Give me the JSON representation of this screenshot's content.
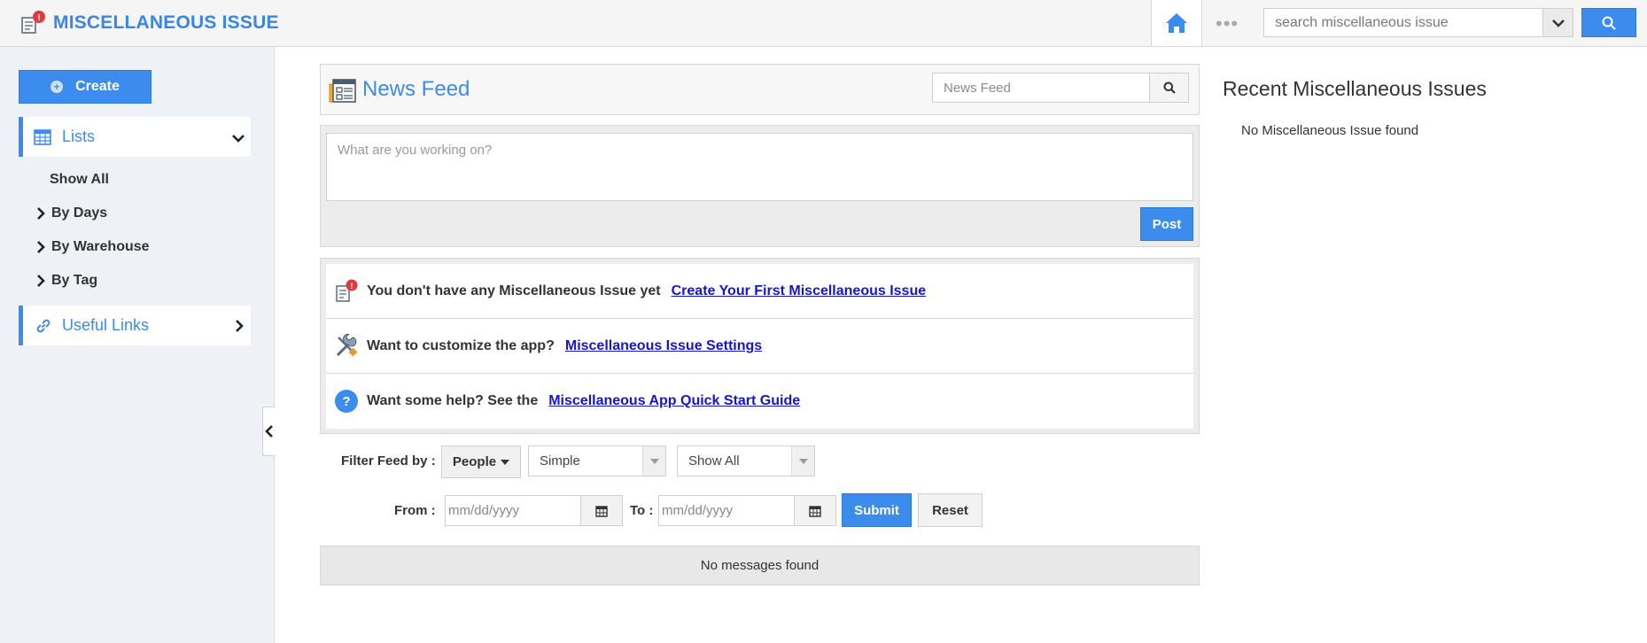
{
  "header": {
    "app_title": "MISCELLANEOUS ISSUE",
    "search_placeholder": "search miscellaneous issue",
    "more_dots": "•••",
    "badge": "!"
  },
  "sidebar": {
    "create_label": "Create",
    "lists_label": "Lists",
    "items": [
      {
        "label": "Show All"
      },
      {
        "label": "By Days"
      },
      {
        "label": "By Warehouse"
      },
      {
        "label": "By Tag"
      }
    ],
    "useful_links_label": "Useful Links"
  },
  "feed": {
    "title": "News Feed",
    "search_placeholder": "News Feed",
    "post_placeholder": "What are you working on?",
    "post_label": "Post"
  },
  "info": {
    "row1_text": "You don't have any Miscellaneous Issue yet",
    "row1_link": "Create Your First Miscellaneous Issue",
    "row2_text": "Want to customize the app?",
    "row2_link": "Miscellaneous Issue Settings",
    "row3_text": "Want some help? See the",
    "row3_link": "Miscellaneous App Quick Start Guide",
    "help_glyph": "?"
  },
  "filter": {
    "label": "Filter Feed by :",
    "people_label": "People",
    "type_value": "Simple",
    "show_value": "Show All",
    "from_label": "From :",
    "to_label": "To :",
    "date_placeholder": "mm/dd/yyyy",
    "submit_label": "Submit",
    "reset_label": "Reset"
  },
  "messages": {
    "empty": "No messages found"
  },
  "recent": {
    "title": "Recent Miscellaneous Issues",
    "empty": "No Miscellaneous Issue found"
  },
  "colors": {
    "accent": "#3b8ced",
    "link": "#1515cf",
    "badge": "#e0393e"
  }
}
